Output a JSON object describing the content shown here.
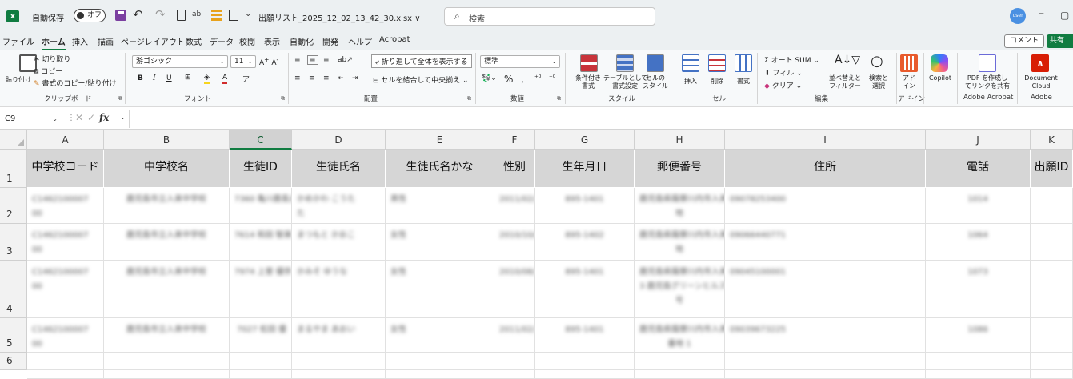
{
  "titlebar": {
    "autosave_label": "自動保存",
    "autosave_state": "オフ",
    "filename": "出願リスト_2025_12_02_13_42_30.xlsx ∨",
    "search_placeholder": "検索",
    "avatar_text": "user"
  },
  "menu": {
    "tabs": [
      "ファイル",
      "ホーム",
      "挿入",
      "描画",
      "ページレイアウト",
      "数式",
      "データ",
      "校閲",
      "表示",
      "自動化",
      "開発",
      "ヘルプ",
      "Acrobat"
    ],
    "active": "ホーム",
    "comment_label": "コメント",
    "share_label": "共有"
  },
  "ribbon": {
    "clipboard": {
      "paste": "貼り付け",
      "cut": "切り取り",
      "copy": "コピー",
      "format_painter": "書式のコピー/貼り付け",
      "group": "クリップボード"
    },
    "font": {
      "name": "游ゴシック",
      "size": "11",
      "group": "フォント"
    },
    "alignment": {
      "wrap": "折り返して全体を表示する",
      "merge": "セルを結合して中央揃え",
      "group": "配置"
    },
    "number": {
      "format": "標準",
      "group": "数値"
    },
    "styles": {
      "conditional": "条件付き\n書式",
      "table": "テーブルとして\n書式設定",
      "cell": "セルの\nスタイル",
      "group": "スタイル"
    },
    "cells": {
      "insert": "挿入",
      "delete": "削除",
      "format": "書式",
      "group": "セル"
    },
    "editing": {
      "autosum": "オート SUM",
      "fill": "フィル",
      "clear": "クリア",
      "sort": "並べ替えと\nフィルター",
      "find": "検索と\n選択",
      "group": "編集"
    },
    "addins": {
      "label": "アド\nイン",
      "group": "アドイン"
    },
    "copilot": {
      "label": "Copilot"
    },
    "acrobat": {
      "label": "PDF を作成し\nてリンクを共有",
      "group": "Adobe Acrobat"
    },
    "adobe": {
      "label": "Document\nCloud",
      "group": "Adobe"
    }
  },
  "formula_bar": {
    "name_box": "C9",
    "fx": "fx",
    "value": ""
  },
  "columns": [
    "A",
    "B",
    "C",
    "D",
    "E",
    "F",
    "G",
    "H",
    "I",
    "J",
    "K"
  ],
  "selected_column": "C",
  "rows": [
    "1",
    "2",
    "3",
    "4",
    "5",
    "6"
  ],
  "headers": [
    "中学校コード",
    "中学校名",
    "生徒ID",
    "生徒氏名",
    "生徒氏名かな",
    "性別",
    "生年月日",
    "郵便番号",
    "住所",
    "電話",
    "出願ID"
  ],
  "data_rows": [
    [
      "C1462100007\n00",
      "鹿児島市立入来中学校",
      "7360 亀川鹿島太",
      "かめかわ こうた\nた",
      "男性",
      "2011/02/25",
      "895-1401",
      "鹿児島県薩摩川内市入来町副田3130 番\n地",
      "09078253400",
      "1014"
    ],
    [
      "C1462100007\n00",
      "鹿児島市立入来中学校",
      "7614 和田 智美子",
      "まつもと かおこ",
      "女性",
      "2010/10/01",
      "895-1402",
      "鹿児島県薩摩川内市入来町浦之名3271番\n地",
      "09066440771",
      "1064"
    ],
    [
      "C1462100007\n00",
      "鹿児島市立入来中学校",
      "7974 上曽 優奈",
      "かみそ ゆうな",
      "女性",
      "2010/08/19",
      "895-1401",
      "鹿児島県薩摩川内市入来町副田6300番地\n3 鹿児島グリーンヒルズ 市営住宅第1\n号",
      "09045100001",
      "1073"
    ],
    [
      "C1462100007\n00",
      "鹿児島市立入来中学校",
      "7027 松田 優",
      "まるやま あおい",
      "女性",
      "2011/02/17",
      "895-1401",
      "鹿児島県薩摩川内市入来町副田4 1 5 2\n番地 1",
      "09039673225",
      "1086"
    ]
  ]
}
